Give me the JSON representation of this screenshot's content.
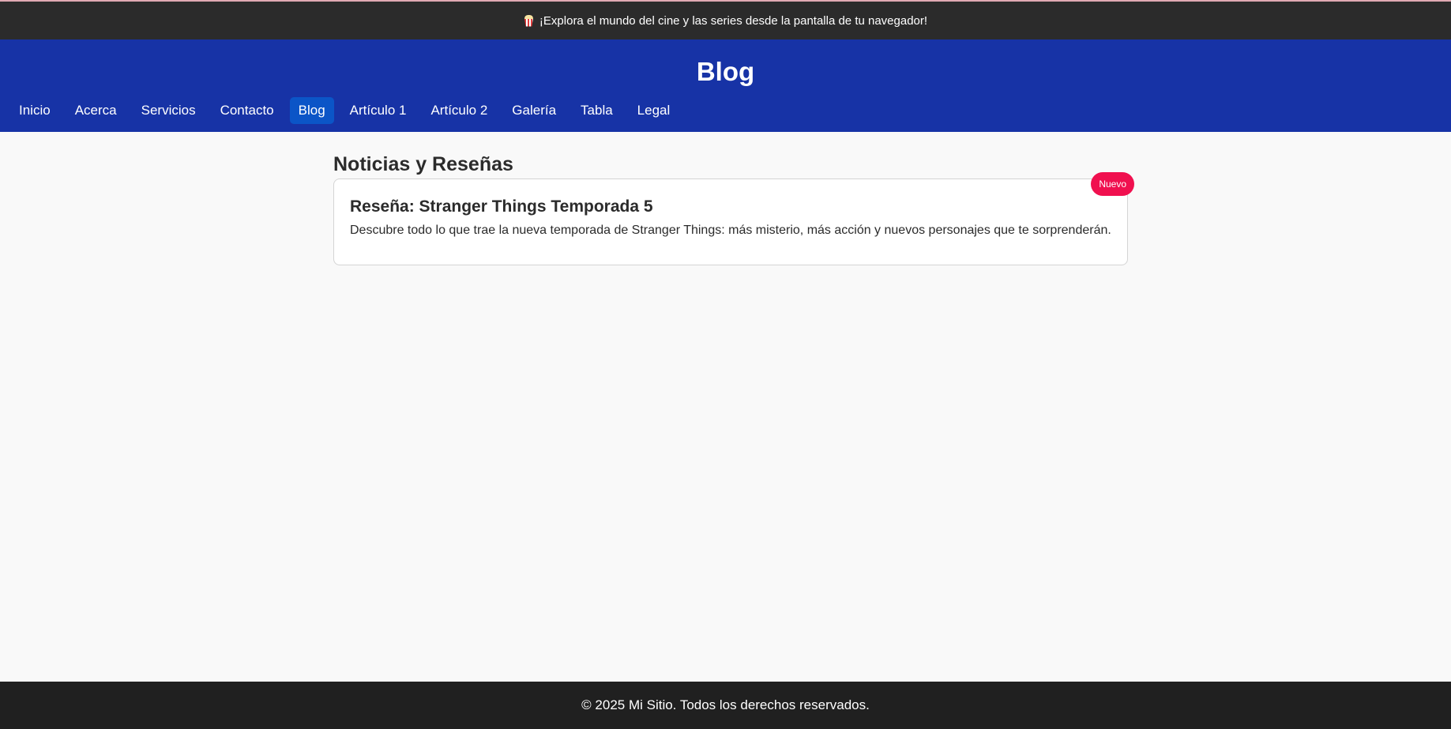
{
  "announcement": {
    "icon": "popcorn-icon",
    "text": "¡Explora el mundo del cine y las series desde la pantalla de tu navegador!"
  },
  "header": {
    "title": "Blog",
    "background": "#1733a6",
    "active_color": "#0b55c7"
  },
  "nav": {
    "items": [
      {
        "label": "Inicio"
      },
      {
        "label": "Acerca"
      },
      {
        "label": "Servicios"
      },
      {
        "label": "Contacto"
      },
      {
        "label": "Blog",
        "active": true
      },
      {
        "label": "Artículo 1"
      },
      {
        "label": "Artículo 2"
      },
      {
        "label": "Galería"
      },
      {
        "label": "Tabla"
      },
      {
        "label": "Legal"
      }
    ]
  },
  "main": {
    "section_title": "Noticias y Reseñas",
    "posts": [
      {
        "title": "Reseña: Stranger Things Temporada 5",
        "text": "Descubre todo lo que trae la nueva temporada de Stranger Things: más misterio, más acción y nuevos personajes que te sorprenderán.",
        "badge": "Nuevo",
        "badge_color": "#f0104f"
      }
    ]
  },
  "footer": {
    "text": "© 2025 Mi Sitio. Todos los derechos reservados."
  }
}
